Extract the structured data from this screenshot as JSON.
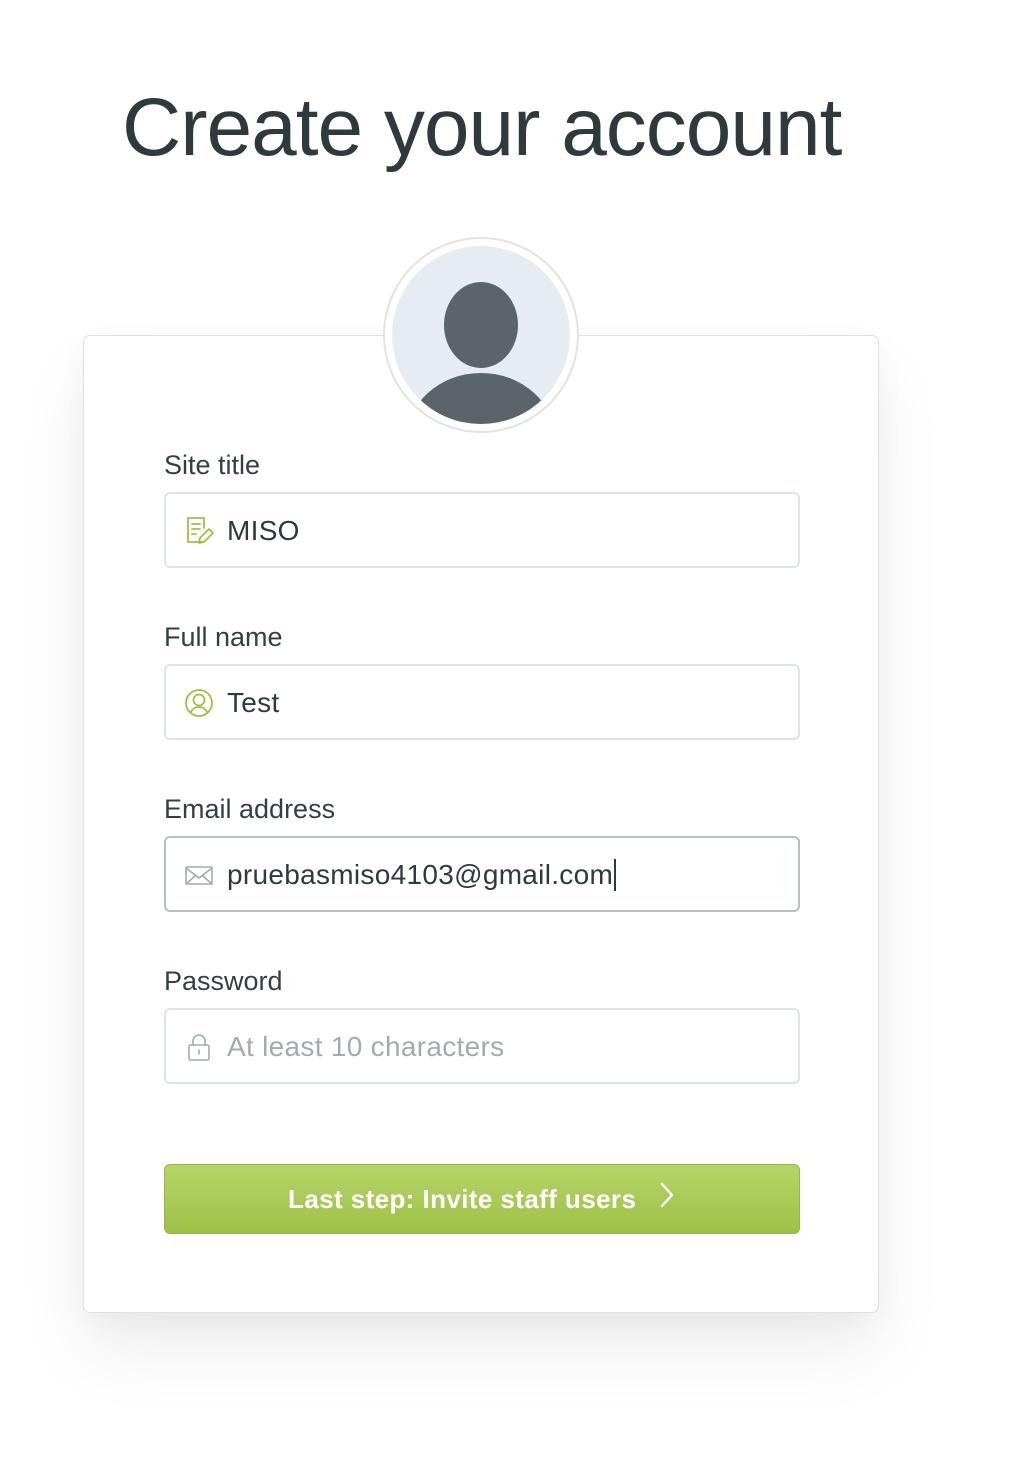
{
  "page": {
    "title": "Create your account"
  },
  "avatar": {
    "icon": "user-avatar-icon",
    "colors": {
      "background": "#e6ecf2",
      "figure": "#5a6469"
    }
  },
  "form": {
    "site_title": {
      "label": "Site title",
      "value": "MISO",
      "icon": "edit-document-icon"
    },
    "full_name": {
      "label": "Full name",
      "value": "Test",
      "icon": "user-circle-icon"
    },
    "email": {
      "label": "Email address",
      "value": "pruebasmiso4103@gmail.com",
      "icon": "envelope-icon"
    },
    "password": {
      "label": "Password",
      "value": "",
      "placeholder": "At least 10 characters",
      "icon": "lock-icon"
    },
    "submit": {
      "label": "Last step: Invite staff users",
      "icon": "chevron-right-icon"
    }
  },
  "colors": {
    "accent": "#9fc047",
    "icon_active": "#9fc047",
    "icon_muted": "#a3abb1",
    "text": "#2f3a3f"
  }
}
